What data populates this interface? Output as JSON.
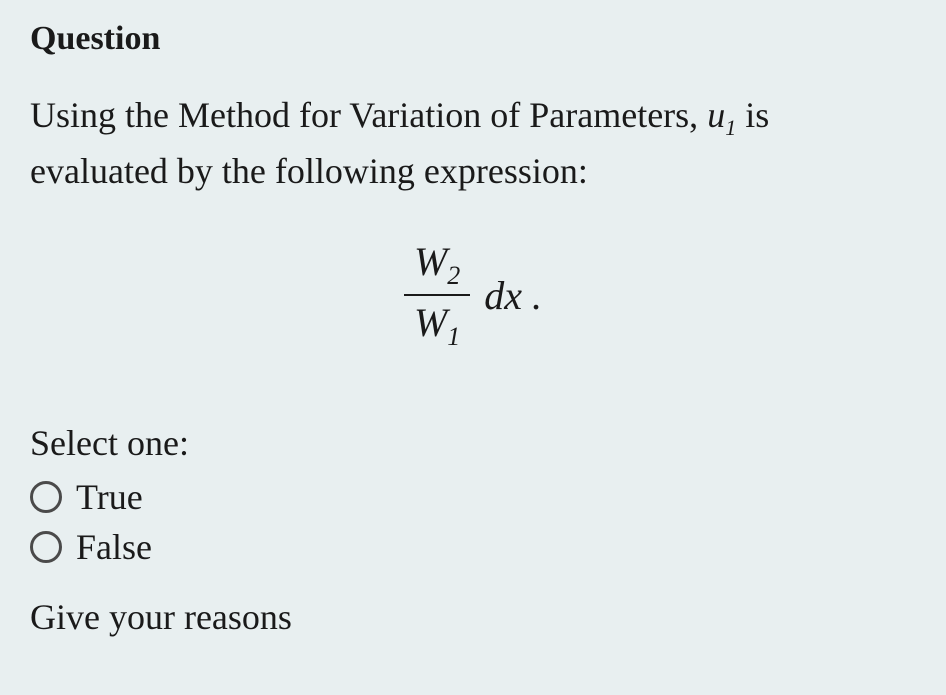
{
  "question": {
    "label": "Question",
    "text_part1": "Using the Method for Variation of Parameters, ",
    "var_u": "u",
    "var_u_sub": "1",
    "text_part2": " is evaluated by the following expression:"
  },
  "formula": {
    "num_var": "W",
    "num_sub": "2",
    "den_var": "W",
    "den_sub": "1",
    "dx_text": "dx ."
  },
  "select": {
    "prompt": "Select one:",
    "options": [
      {
        "label": "True"
      },
      {
        "label": "False"
      }
    ]
  },
  "reasons": {
    "label": "Give your reasons"
  }
}
